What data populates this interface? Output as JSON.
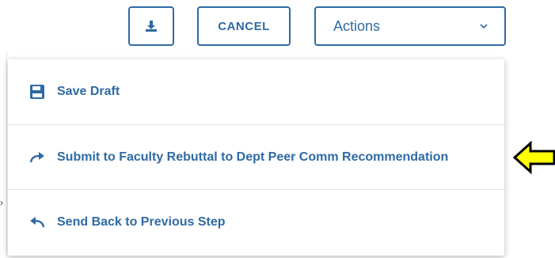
{
  "toolbar": {
    "download_icon": "download-icon",
    "cancel_label": "CANCEL",
    "actions_label": "Actions",
    "actions_chevron": "chevron-down-icon"
  },
  "menu": {
    "items": [
      {
        "label": "Save Draft",
        "icon": "save-icon"
      },
      {
        "label": "Submit to Faculty Rebuttal to Dept Peer Comm Recommendation",
        "icon": "forward-arrow-icon"
      },
      {
        "label": "Send Back to Previous Step",
        "icon": "back-arrow-icon"
      }
    ]
  },
  "annotation": {
    "icon": "yellow-arrow-pointer-icon",
    "fill_color": "#ffff00",
    "stroke_color": "#000000"
  },
  "colors": {
    "accent": "#2f6aa3",
    "divider": "#e3e3e3"
  }
}
